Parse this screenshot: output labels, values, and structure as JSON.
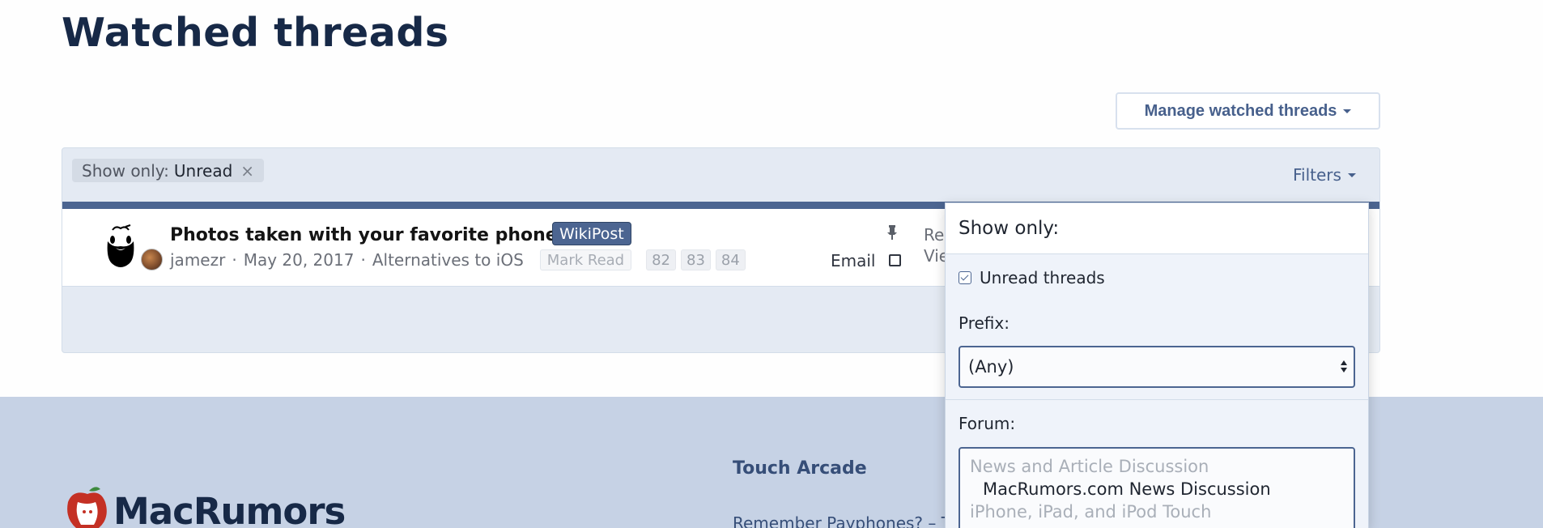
{
  "page": {
    "title": "Watched threads"
  },
  "toolbar": {
    "manage_label": "Manage watched threads"
  },
  "filter_bar": {
    "chip_prefix": "Show only:",
    "chip_value": "Unread",
    "chip_remove": "×",
    "filters_label": "Filters"
  },
  "thread": {
    "title": "Photos taken with your favorite phone!",
    "prefix": "WikiPost",
    "author": "jamezr",
    "separator": "·",
    "date": "May 20, 2017",
    "forum": "Alternatives to iOS",
    "mark_read": "Mark Read",
    "pages": [
      "82",
      "83",
      "84"
    ],
    "email_label": "Email",
    "stat_1_cut": "Re",
    "stat_2_cut": "Vie"
  },
  "filter_menu": {
    "header": "Show only:",
    "unread_label": "Unread threads",
    "prefix_label": "Prefix:",
    "prefix_value": "(Any)",
    "forum_label": "Forum:",
    "forum_options": [
      {
        "text": "News and Article Discussion",
        "kind": "group"
      },
      {
        "text": "MacRumors.com News Discussion",
        "kind": "item"
      },
      {
        "text": "iPhone, iPad, and iPod Touch",
        "kind": "group"
      }
    ]
  },
  "footer": {
    "logo_text": "MacRumors",
    "col_heading": "Touch Arcade",
    "col_link": "Remember Payphones? – T"
  },
  "colors": {
    "accent": "#4c6591",
    "title": "#172947",
    "footer_bg": "#c6d2e5",
    "block_bg": "#e4eaf3"
  }
}
